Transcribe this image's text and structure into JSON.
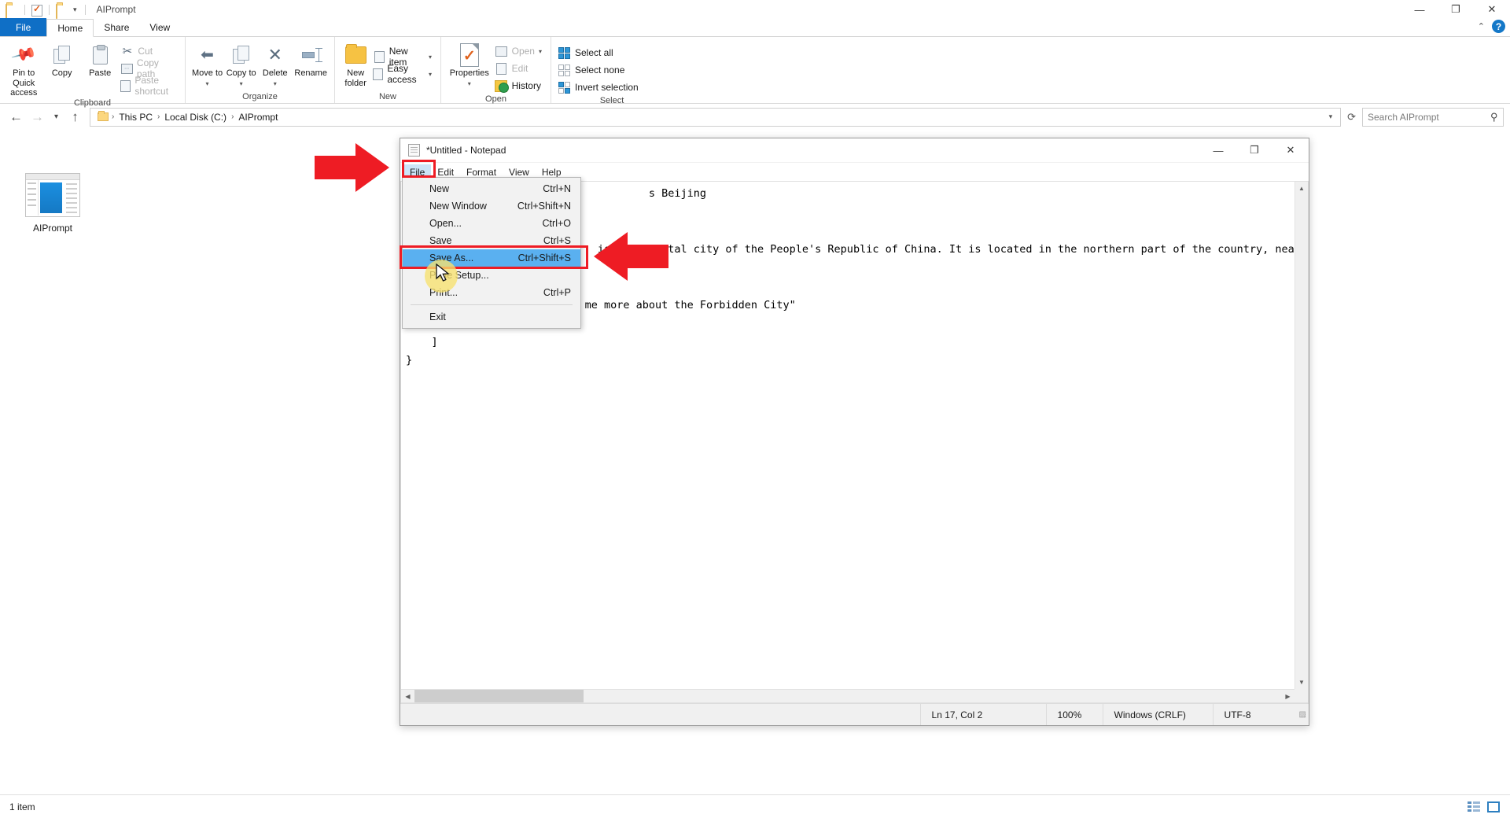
{
  "explorer": {
    "window_title": "AIPrompt",
    "quick_access": {
      "folder_icon": "folder-icon",
      "properties_icon": "properties-check-icon",
      "new_folder_icon": "new-folder-icon",
      "customize_icon": "chevron-down-icon"
    },
    "window_controls": {
      "minimize": "—",
      "maximize": "❐",
      "close": "✕"
    },
    "tabs": [
      {
        "label": "File",
        "active": false,
        "kind": "file"
      },
      {
        "label": "Home",
        "active": true
      },
      {
        "label": "Share",
        "active": false
      },
      {
        "label": "View",
        "active": false
      }
    ],
    "help": {
      "collapse_icon": "chevron-up-icon",
      "help_icon": "help-question-icon",
      "help_label": "?"
    },
    "ribbon_groups": [
      {
        "name": "Clipboard",
        "label": "Clipboard",
        "big_buttons": [
          {
            "label": "Pin to Quick access",
            "icon": "pin-icon"
          },
          {
            "label": "Copy",
            "icon": "copy-icon"
          },
          {
            "label": "Paste",
            "icon": "paste-icon"
          }
        ],
        "small_buttons": [
          {
            "label": "Cut",
            "icon": "scissors-icon",
            "disabled": true
          },
          {
            "label": "Copy path",
            "icon": "copy-path-icon",
            "disabled": true
          },
          {
            "label": "Paste shortcut",
            "icon": "paste-shortcut-icon",
            "disabled": true
          }
        ]
      },
      {
        "name": "Organize",
        "label": "Organize",
        "big_buttons": [
          {
            "label": "Move to",
            "icon": "move-to-icon",
            "caret": true
          },
          {
            "label": "Copy to",
            "icon": "copy-to-icon",
            "caret": true
          },
          {
            "label": "Delete",
            "icon": "delete-x-icon",
            "caret": true
          },
          {
            "label": "Rename",
            "icon": "rename-icon"
          }
        ]
      },
      {
        "name": "New",
        "label": "New",
        "big_buttons": [
          {
            "label": "New folder",
            "icon": "new-folder-icon"
          }
        ],
        "small_buttons": [
          {
            "label": "New item",
            "icon": "new-item-icon",
            "caret": true
          },
          {
            "label": "Easy access",
            "icon": "easy-access-icon",
            "caret": true,
            "disabled": false
          }
        ]
      },
      {
        "name": "Open",
        "label": "Open",
        "big_buttons": [
          {
            "label": "Properties",
            "icon": "properties-icon",
            "caret": true
          }
        ],
        "small_buttons": [
          {
            "label": "Open",
            "icon": "open-icon",
            "caret": true,
            "disabled": true
          },
          {
            "label": "Edit",
            "icon": "edit-icon",
            "disabled": true
          },
          {
            "label": "History",
            "icon": "history-icon",
            "disabled": false
          }
        ]
      },
      {
        "name": "Select",
        "label": "Select",
        "small_buttons": [
          {
            "label": "Select all",
            "icon": "select-all-icon"
          },
          {
            "label": "Select none",
            "icon": "select-none-icon"
          },
          {
            "label": "Invert selection",
            "icon": "invert-selection-icon"
          }
        ]
      }
    ],
    "address": {
      "back_icon": "back-arrow-icon",
      "forward_icon": "forward-arrow-icon",
      "recent_icon": "chevron-down-icon",
      "up_icon": "up-arrow-icon",
      "breadcrumbs": [
        "This PC",
        "Local Disk (C:)",
        "AIPrompt"
      ],
      "separator": "›",
      "dropdown_icon": "chevron-down-icon",
      "refresh_icon": "refresh-icon"
    },
    "search": {
      "placeholder": "Search AIPrompt",
      "value": "",
      "icon": "search-icon"
    },
    "items": [
      {
        "label": "AIPrompt",
        "icon": "aiprompt-file-thumbnail"
      }
    ],
    "status": {
      "count_label": "1 item",
      "details_view_icon": "details-view-icon",
      "large_icons_view_icon": "large-icons-view-icon"
    }
  },
  "notepad": {
    "title": "*Untitled - Notepad",
    "icon": "notepad-icon",
    "window_controls": {
      "minimize": "—",
      "maximize": "❐",
      "close": "✕"
    },
    "menu": [
      {
        "label": "File",
        "open": true
      },
      {
        "label": "Edit",
        "open": false
      },
      {
        "label": "Format",
        "open": false
      },
      {
        "label": "View",
        "open": false
      },
      {
        "label": "Help",
        "open": false
      }
    ],
    "file_menu": {
      "items": [
        {
          "label": "New",
          "accel": "Ctrl+N",
          "selected": false
        },
        {
          "label": "New Window",
          "accel": "Ctrl+Shift+N",
          "selected": false
        },
        {
          "label": "Open...",
          "accel": "Ctrl+O",
          "selected": false
        },
        {
          "label": "Save",
          "accel": "Ctrl+S",
          "selected": false
        },
        {
          "label": "Save As...",
          "accel": "Ctrl+Shift+S",
          "selected": true
        },
        {
          "label": "Page Setup...",
          "accel": "",
          "selected": false
        },
        {
          "label": "Print...",
          "accel": "Ctrl+P",
          "selected": false
        },
        {
          "separator": true
        },
        {
          "label": "Exit",
          "accel": "",
          "selected": false
        }
      ]
    },
    "text": "                                      s Beijing\n\n\n                              is the capital city of the People's Republic of China. It is located in the northern part of the country, near the\n        {\n            \"role\":\"user\",\n            \"content\":\"Tell me more about the Forbidden City\"\n        }\n    ]\n}",
    "status": {
      "position": "Ln 17, Col 2",
      "zoom": "100%",
      "line_ending": "Windows (CRLF)",
      "encoding": "UTF-8"
    }
  },
  "annotations": {
    "arrow_to_file_menu": "red-right-arrow",
    "arrow_to_save_as": "red-right-arrow",
    "highlight_file_button": "red-rectangle",
    "highlight_save_as_item": "red-rectangle",
    "cursor": "mouse-pointer"
  }
}
